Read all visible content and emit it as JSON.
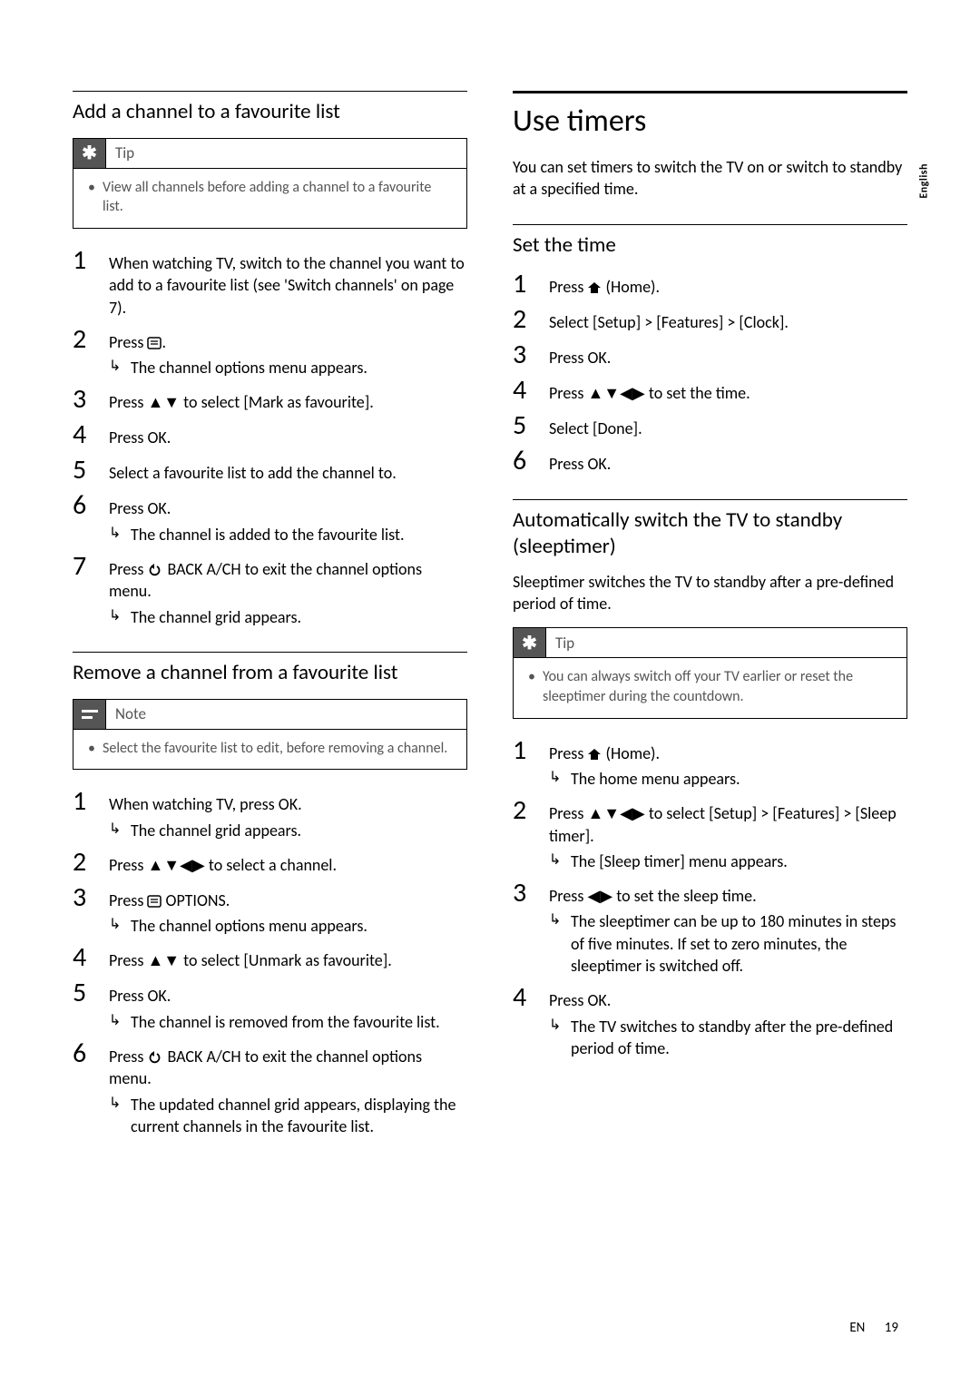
{
  "side_tab": "English",
  "left": {
    "h_add": "Add a channel to a favourite list",
    "tip_label": "Tip",
    "tip_body": "View all channels before adding a channel to a favourite list.",
    "steps_add": [
      {
        "n": "1",
        "t": "When watching TV, switch to the channel you want to add to a favourite list (see 'Switch channels' on page 7)."
      },
      {
        "n": "2",
        "t_pre": "Press ",
        "t_post": ".",
        "r": "The channel options menu appears."
      },
      {
        "n": "3",
        "t_pre": "Press ",
        "t_mid": " to select ",
        "b": "[Mark as favourite]",
        "t_post": "."
      },
      {
        "n": "4",
        "t_pre": "Press ",
        "b": "OK",
        "t_post": "."
      },
      {
        "n": "5",
        "t": "Select a favourite list to add the channel to."
      },
      {
        "n": "6",
        "t_pre": "Press ",
        "b": "OK",
        "t_post": ".",
        "r": "The channel is added to the favourite list."
      },
      {
        "n": "7",
        "t_pre": "Press ",
        "b": " BACK A/CH",
        "t_post": " to exit the channel options menu.",
        "r": "The channel grid appears."
      }
    ],
    "h_remove": "Remove a channel from a favourite list",
    "note_label": "Note",
    "note_body": "Select the favourite list to edit, before removing a channel.",
    "steps_remove": [
      {
        "n": "1",
        "t_pre": "When watching TV, press ",
        "b": "OK",
        "t_post": ".",
        "r": "The channel grid appears."
      },
      {
        "n": "2",
        "t_pre": "Press ",
        "t_post": " to select a channel."
      },
      {
        "n": "3",
        "t_pre": "Press ",
        "b": " OPTIONS",
        "t_post": ".",
        "r": "The channel options menu appears."
      },
      {
        "n": "4",
        "t_pre": "Press ",
        "t_mid": " to select ",
        "b": "[Unmark as favourite]",
        "t_post": "."
      },
      {
        "n": "5",
        "t_pre": "Press ",
        "b": "OK",
        "t_post": ".",
        "r": "The channel is removed from the favourite list."
      },
      {
        "n": "6",
        "t_pre": "Press ",
        "b": " BACK A/CH",
        "t_post": " to exit the channel options menu.",
        "r": "The updated channel grid appears, displaying the current channels in the favourite list."
      }
    ]
  },
  "right": {
    "h_timers": "Use timers",
    "intro": "You can set timers to switch the TV on or switch to standby at a specified time.",
    "h_settime": "Set the time",
    "steps_time": [
      {
        "n": "1",
        "t_pre": "Press ",
        "b_home": "Home",
        "t_post": ")."
      },
      {
        "n": "2",
        "t_pre": "Select ",
        "b": "[Setup]",
        "mid1": " > ",
        "b2": "[Features]",
        "mid2": " > ",
        "b3": "[Clock]",
        "t_post": "."
      },
      {
        "n": "3",
        "t_pre": "Press ",
        "b": "OK",
        "t_post": "."
      },
      {
        "n": "4",
        "t_pre": "Press ",
        "t_post": " to set the time."
      },
      {
        "n": "5",
        "t_pre": "Select ",
        "b": "[Done]",
        "t_post": "."
      },
      {
        "n": "6",
        "t_pre": "Press ",
        "b": "OK",
        "t_post": "."
      }
    ],
    "h_sleep": "Automatically switch the TV to standby (sleeptimer)",
    "sleep_intro": "Sleeptimer switches the TV to standby after a pre-defined period of time.",
    "tip_label": "Tip",
    "tip_body": "You can always switch off your TV earlier or reset the sleeptimer during the countdown.",
    "steps_sleep": [
      {
        "n": "1",
        "t_pre": "Press ",
        "b_home": "Home",
        "t_post": ").",
        "r": "The home menu appears."
      },
      {
        "n": "2",
        "t_pre": "Press ",
        "t_mid": " to select ",
        "b": "[Setup]",
        "mid1": " > ",
        "b2": "[Features]",
        "mid2": " > ",
        "b3": "[Sleep timer]",
        "t_post": ".",
        "r_pre": "The ",
        "r_b": "[Sleep timer]",
        "r_post": " menu appears."
      },
      {
        "n": "3",
        "t_pre": "Press ",
        "t_post": " to set the sleep time.",
        "r": "The sleeptimer can be up to 180 minutes in steps of five minutes. If set to zero minutes, the sleeptimer is switched off."
      },
      {
        "n": "4",
        "t_pre": "Press ",
        "b": "OK",
        "t_post": ".",
        "r": "The TV switches to standby after the pre-defined period of time."
      }
    ]
  },
  "footer": {
    "lang": "EN",
    "page": "19"
  }
}
